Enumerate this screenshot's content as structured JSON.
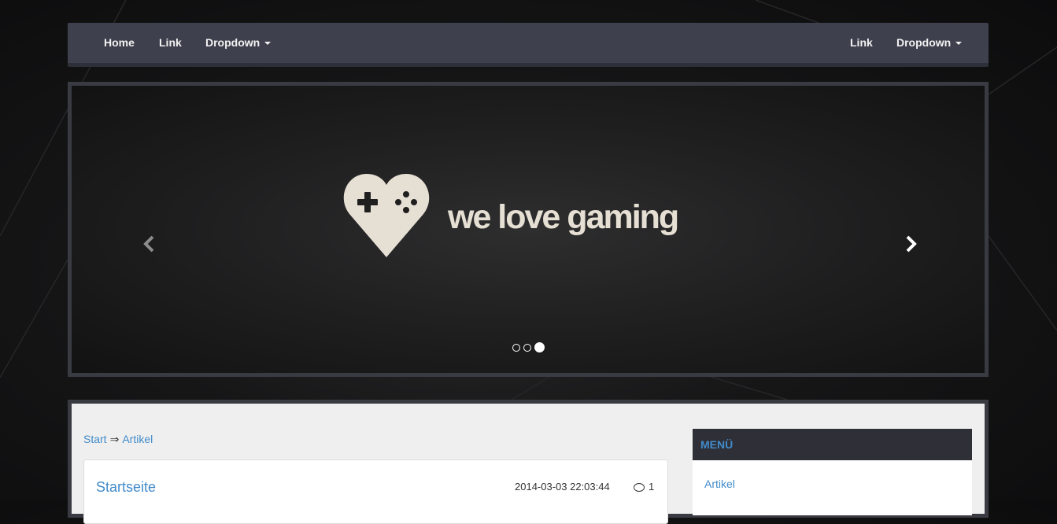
{
  "navbar": {
    "left": [
      {
        "label": "Home"
      },
      {
        "label": "Link"
      },
      {
        "label": "Dropdown"
      }
    ],
    "right": [
      {
        "label": "Link"
      },
      {
        "label": "Dropdown"
      }
    ]
  },
  "carousel": {
    "slide_text": "we love gaming",
    "indicator_count": 3,
    "active_indicator": 3,
    "logo_color": "#e6dfd3"
  },
  "breadcrumb": {
    "items": [
      "Start",
      "Artikel"
    ],
    "separator": "⇒"
  },
  "article": {
    "title": "Startseite",
    "date": "2014-03-03 22:03:44",
    "comments": "1"
  },
  "sidebar": {
    "heading": "MENÜ",
    "link": "Artikel"
  },
  "colors": {
    "link": "#428bca",
    "navbar": "#3e414d",
    "sidebar_head": "#2e2f37"
  }
}
